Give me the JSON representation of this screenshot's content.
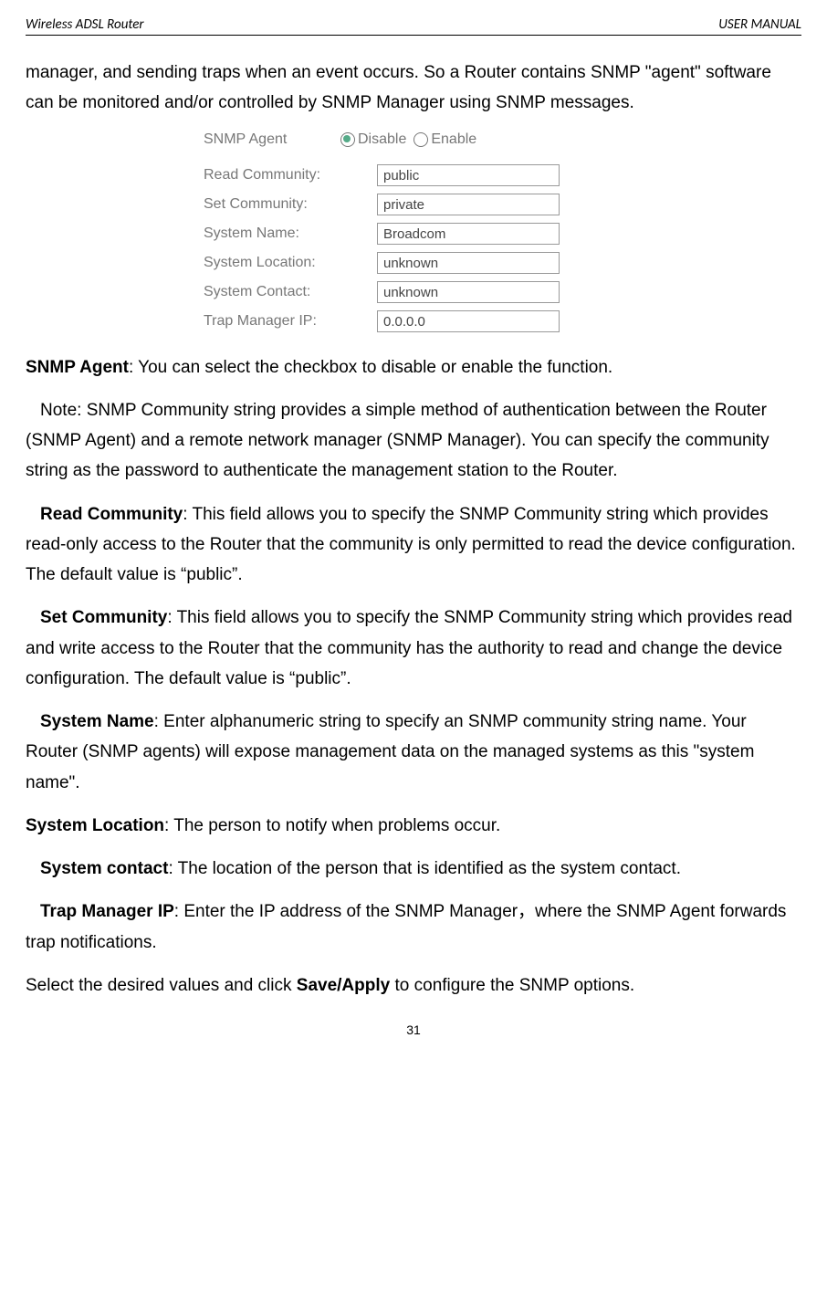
{
  "header": {
    "left": "Wireless ADSL Router",
    "right": "USER MANUAL"
  },
  "intro": "manager, and sending traps when an event occurs. So a Router contains SNMP \"agent\" software can be monitored and/or controlled by SNMP Manager using SNMP messages.",
  "form": {
    "agent_label": "SNMP Agent",
    "options": {
      "disable": "Disable",
      "enable": "Enable"
    },
    "rows": [
      {
        "label": "Read Community:",
        "value": "public"
      },
      {
        "label": "Set Community:",
        "value": "private"
      },
      {
        "label": "System Name:",
        "value": "Broadcom"
      },
      {
        "label": "System Location:",
        "value": "unknown"
      },
      {
        "label": "System Contact:",
        "value": "unknown"
      },
      {
        "label": "Trap Manager IP:",
        "value": "0.0.0.0"
      }
    ]
  },
  "sections": {
    "snmp_agent": {
      "term": "SNMP Agent",
      "text": ": You can select the checkbox to disable or enable the function."
    },
    "note": "Note: SNMP Community string provides a simple method of authentication between the Router (SNMP Agent) and a remote network manager (SNMP Manager). You can specify the community string as the password to authenticate the management station to the Router.",
    "read_community": {
      "term": "Read Community",
      "text": ": This field allows you to specify the SNMP Community string which provides read-only access to the Router that the community is only permitted to read the device configuration. The default value is “public”."
    },
    "set_community": {
      "term": "Set Community",
      "text": ": This field allows you to specify the SNMP Community string which provides read and write access to the Router that the community has the authority to read and change the device configuration. The default value is “public”."
    },
    "system_name": {
      "term": "System Name",
      "text": ": Enter alphanumeric string to specify an SNMP community string name. Your Router (SNMP agents) will expose management data on the managed systems as this \"system name\"."
    },
    "system_location": {
      "term": "System Location",
      "text": ": The person to notify when problems occur."
    },
    "system_contact": {
      "term": "System contact",
      "text": ": The location of the person that is identified as the system contact."
    },
    "trap_manager_ip": {
      "term": "Trap Manager IP",
      "text": ": Enter the IP address of the SNMP Manager，where the SNMP Agent forwards trap notifications."
    },
    "footer_pre": "Select the desired values and click ",
    "footer_bold": "Save/Apply",
    "footer_post": " to configure the SNMP options."
  },
  "page_number": "31"
}
